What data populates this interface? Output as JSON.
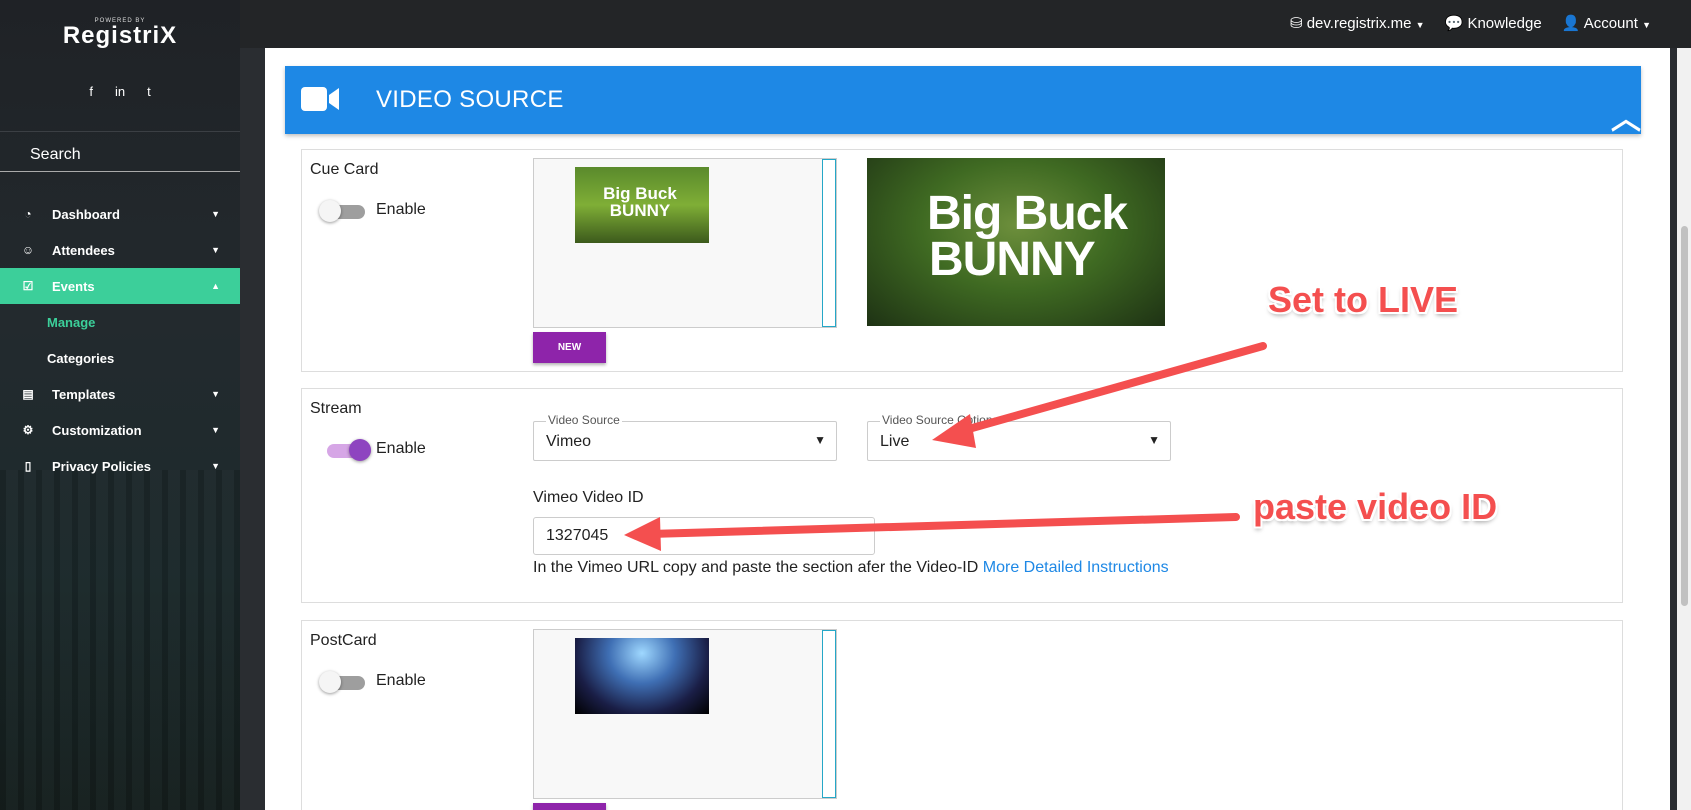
{
  "sidebar": {
    "logo_small": "POWERED BY",
    "logo_text": "RegistriX",
    "social": [
      "f",
      "in",
      "t"
    ],
    "search_label": "Search",
    "items": [
      {
        "label": "Dashboard",
        "icon": "gauge-icon"
      },
      {
        "label": "Attendees",
        "icon": "smile-icon"
      },
      {
        "label": "Events",
        "icon": "calendar-check-icon"
      },
      {
        "label": "Manage"
      },
      {
        "label": "Categories"
      },
      {
        "label": "Templates",
        "icon": "layout-icon"
      },
      {
        "label": "Customization",
        "icon": "gear-icon"
      },
      {
        "label": "Privacy Policies",
        "icon": "file-icon"
      }
    ]
  },
  "topbar": {
    "site": "dev.registrix.me",
    "knowledge": "Knowledge",
    "account": "Account"
  },
  "section": {
    "title": "VIDEO SOURCE"
  },
  "cue_card": {
    "label": "Cue Card",
    "toggle_label": "Enable",
    "enabled": false,
    "thumb_text": "Big Buck BUNNY",
    "preview_text_1": "Big Buck",
    "preview_text_2": "BUNNY",
    "new_button": "NEW"
  },
  "stream": {
    "label": "Stream",
    "toggle_label": "Enable",
    "enabled": true,
    "video_source_label": "Video Source",
    "video_source_value": "Vimeo",
    "video_source_options_label": "Video Source Options",
    "video_source_options_value": "Live",
    "vimeo_id_label": "Vimeo Video ID",
    "vimeo_id_value": "1327045",
    "help_text": "In the Vimeo URL copy and paste the section afer the Video-ID",
    "help_link": "More Detailed Instructions"
  },
  "postcard": {
    "label": "PostCard",
    "toggle_label": "Enable",
    "enabled": false
  },
  "annotations": {
    "set_live": "Set to LIVE",
    "paste_id": "paste video ID"
  },
  "colors": {
    "header_blue": "#1e88e5",
    "active_green": "#3ccf9a",
    "purple": "#8e24aa",
    "annotation_red": "#f44f4f"
  }
}
